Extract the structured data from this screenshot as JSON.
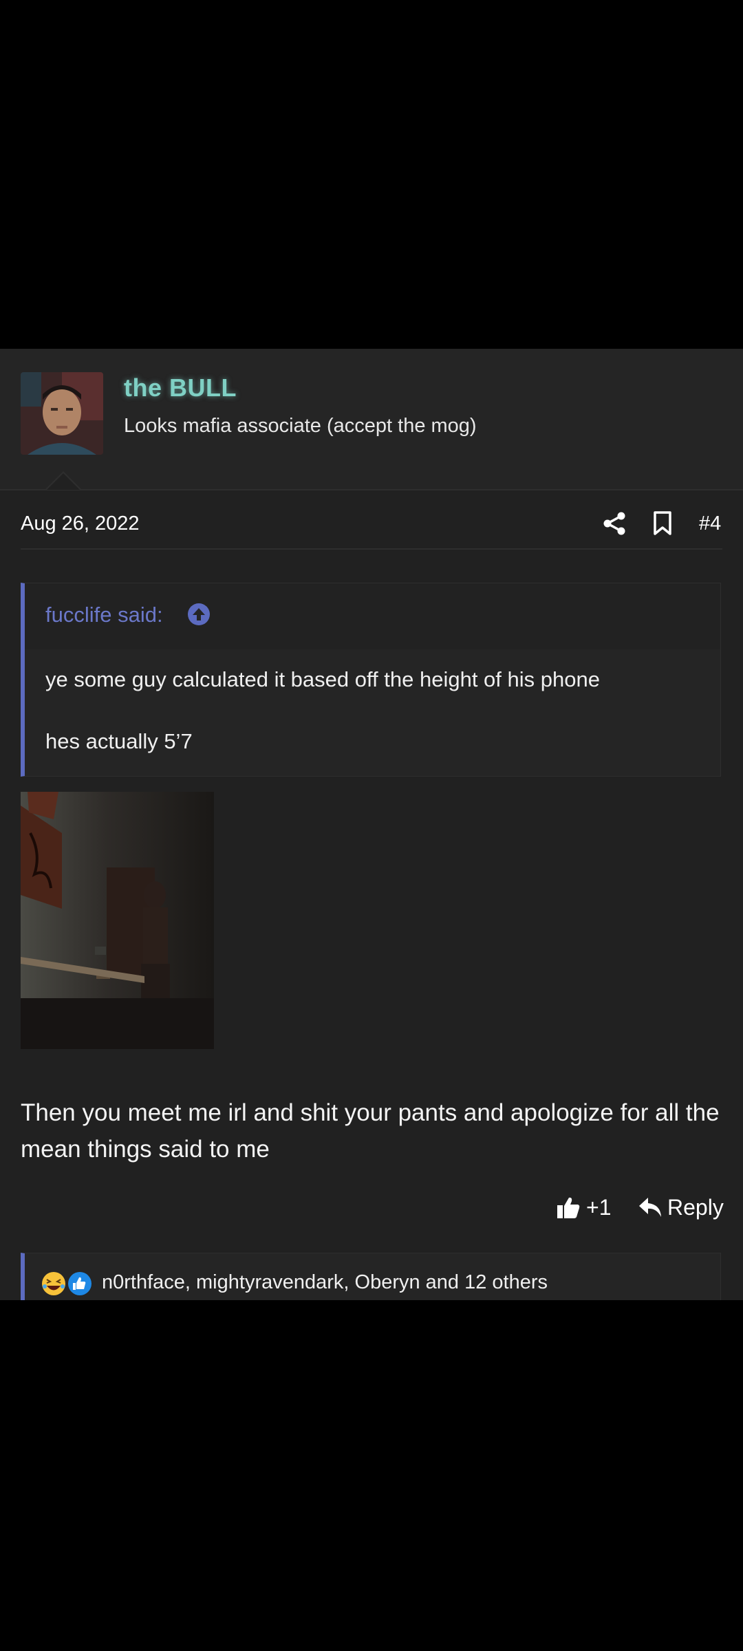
{
  "user": {
    "name": "the BULL",
    "title": "Looks mafia associate (accept the mog)"
  },
  "meta": {
    "date": "Aug 26, 2022",
    "post_number": "#4"
  },
  "quote": {
    "author_label": "fucclife said:",
    "lines": [
      "ye some guy calculated it based off the height of his phone",
      "hes actually 5’7"
    ]
  },
  "body": {
    "text": "Then you meet me irl and shit your pants and apologize for all the mean things said to me"
  },
  "actions": {
    "like_label": "+1",
    "reply_label": "Reply"
  },
  "reactions": {
    "summary": "n0rthface, mightyravendark, Oberyn and 12 others",
    "icons": [
      "laughing-face-icon",
      "thumbs-up-icon"
    ]
  },
  "colors": {
    "accent": "#5c6bc0",
    "username": "#7fd0c4",
    "post_bg": "#212121",
    "header_bg": "#252525"
  }
}
